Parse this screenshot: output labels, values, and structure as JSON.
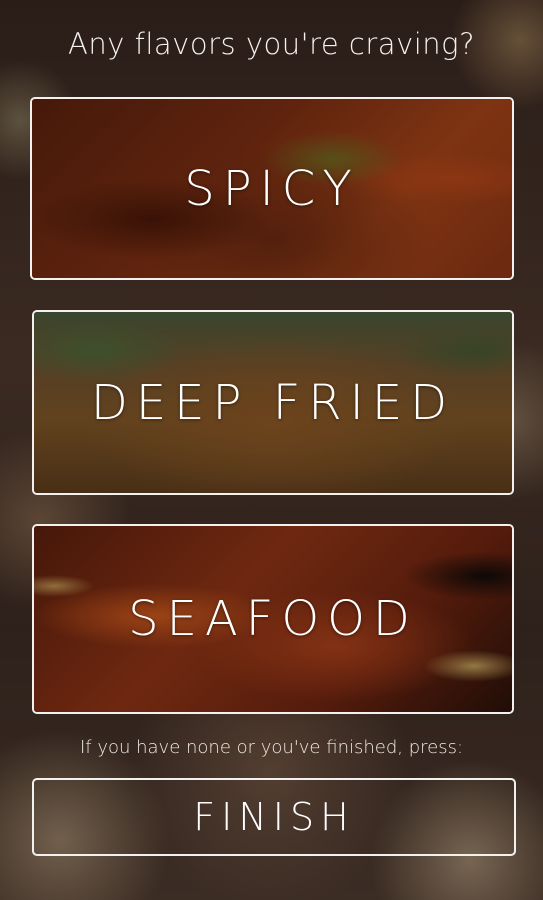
{
  "prompt": "Any flavors you're craving?",
  "options": [
    {
      "label": "SPICY"
    },
    {
      "label": "DEEP FRIED"
    },
    {
      "label": "SEAFOOD"
    }
  ],
  "hint": "If you have none or you've finished, press:",
  "finish_label": "FINISH"
}
